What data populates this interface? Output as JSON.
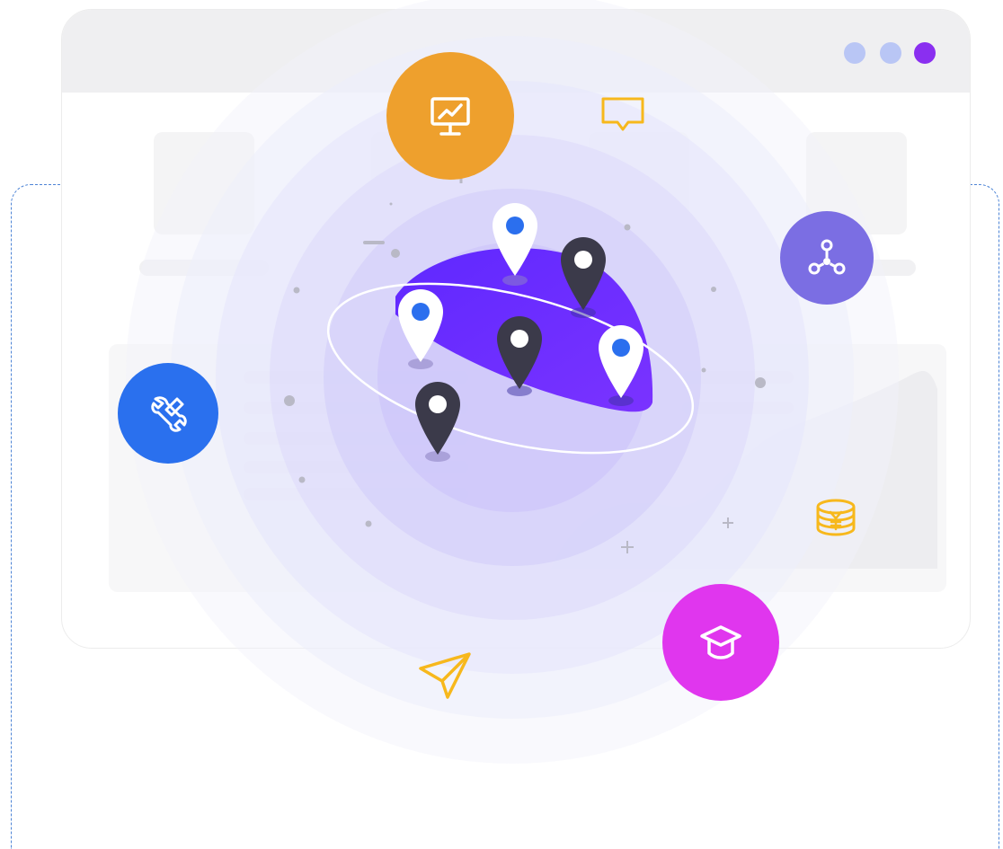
{
  "colors": {
    "accent_purple": "#6b2fff",
    "orange_badge": "#eea02d",
    "blue_badge": "#2a70ee",
    "violet_badge": "#7b6ee3",
    "magenta_badge": "#e036ee",
    "yellow_line_icons": "#f7b81c",
    "pin_dark": "#3b3a4a",
    "pin_blue_dot": "#2b6fee",
    "window_dots": [
      "#b9c6f5",
      "#b9c6f5",
      "#8a2ff0"
    ]
  },
  "icons": {
    "orange_badge": "presentation-chart-icon",
    "violet_badge": "network-nodes-icon",
    "blue_badge": "tools-wrench-icon",
    "magenta_badge": "graduation-cap-icon",
    "chat": "chat-bubble-icon",
    "coins": "yen-coins-icon",
    "send": "paper-plane-icon"
  }
}
